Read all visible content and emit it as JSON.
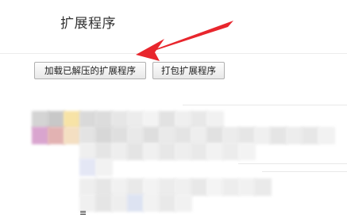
{
  "page": {
    "title": "扩展程序"
  },
  "toolbar": {
    "load_unpacked_label": "加载已解压的扩展程序",
    "pack_label": "打包扩展程序"
  },
  "obscured_region": {
    "partial_text": "≡"
  },
  "annotation": {
    "arrow_color": "#e8262d"
  }
}
